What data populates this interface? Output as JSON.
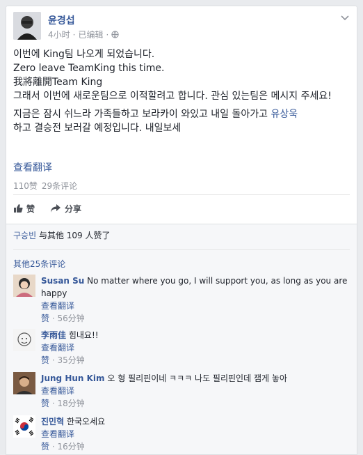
{
  "post": {
    "author": "윤경섭",
    "time": "4小时",
    "edited": "已编辑",
    "body": [
      "이번에 King팀 나오게 되었습니다.\nZero leave TeamKing this time.\n我將離開Team King\n그래서 이번에 새로운팀으로 이적할려고 합니다. 관심 있는팀은 메시지 주세요!"
    ],
    "body2_pre": "지금은 잠시 쉬느라 가족들하고 보라카이 와있고 내일 돌아가고 ",
    "body2_link": "유상욱",
    "body2_post": "\n하고 결승전 보러갈 예정입니다. 내일보세",
    "translate": "查看翻译",
    "likes_count": "110赞",
    "comments_count": "29条评论",
    "like_label": "赞",
    "share_label": "分享"
  },
  "ufi": {
    "liker": "구승빈",
    "likes_rest": "与其他 109 人赞了",
    "more_comments": "其他25条评论"
  },
  "comments": [
    {
      "author": "Susan Su",
      "text": "No matter where you go, I will support you, as long as you are happy",
      "translate": "查看翻译",
      "like": "赞",
      "time": "56分钟"
    },
    {
      "author": "李雨佳",
      "text": "힘내요!!",
      "translate": "查看翻译",
      "like": "赞",
      "time": "35分钟"
    },
    {
      "author": "Jung Hun Kim",
      "text": "오 형 필리핀이네 ㅋㅋㅋ 나도 필리핀인데 잼게 놓아",
      "translate": "查看翻译",
      "like": "赞",
      "time": "18分钟"
    },
    {
      "author": "진민혁",
      "text": "한국오세요",
      "translate": "查看翻译",
      "like": "赞",
      "time": "16分钟"
    }
  ],
  "icons": {
    "chevron": "chevron-down-icon",
    "globe": "globe-icon",
    "like": "thumbs-up-icon",
    "share": "share-arrow-icon"
  },
  "colors": {
    "link": "#365899",
    "meta": "#90949c",
    "text": "#1d2129"
  }
}
